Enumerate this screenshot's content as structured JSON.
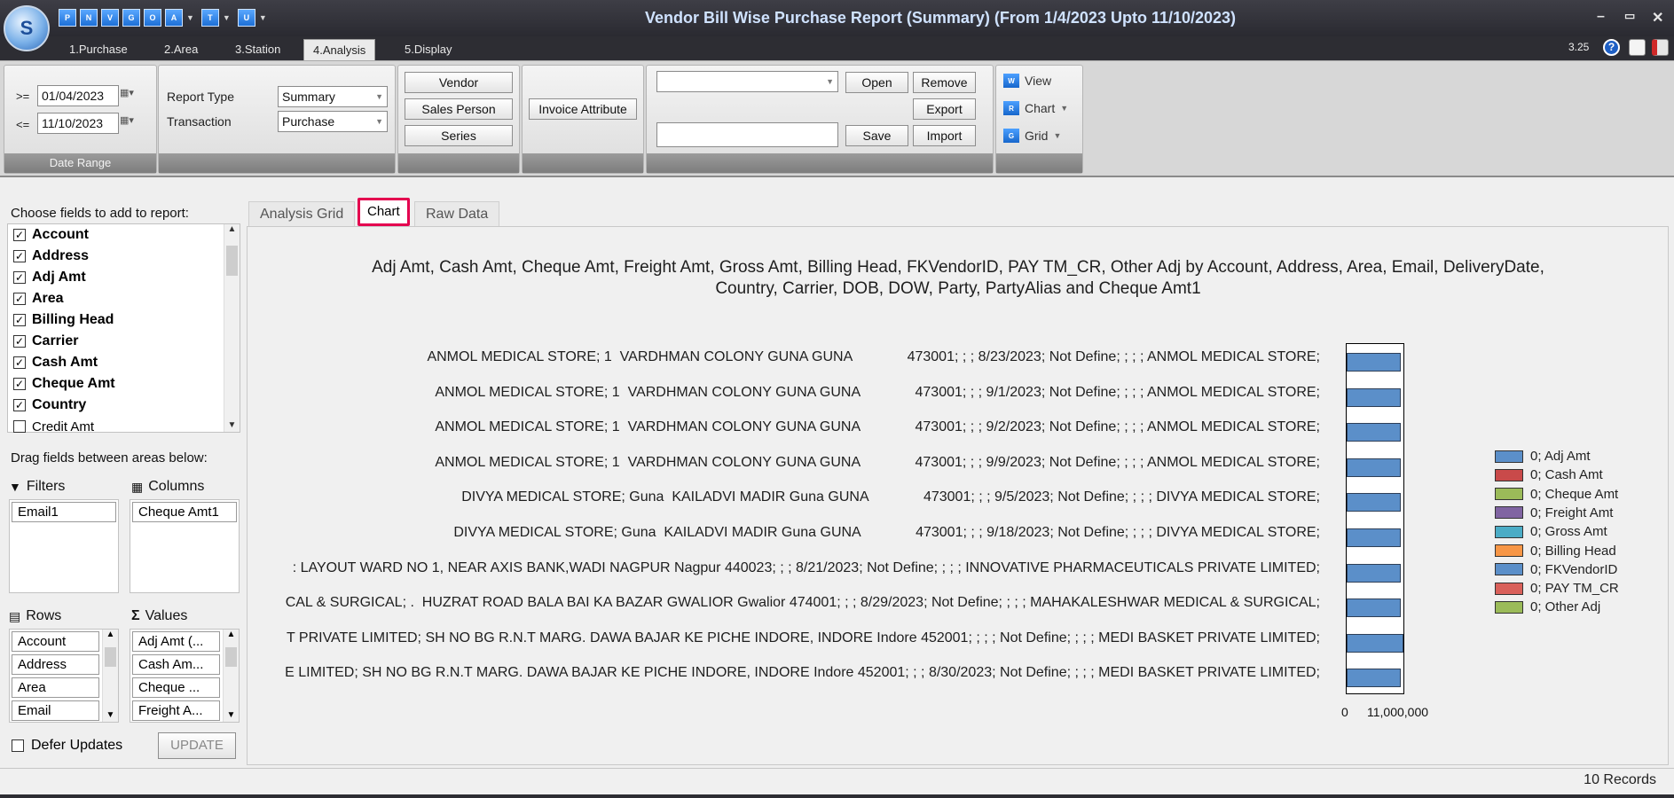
{
  "window": {
    "title": "Vendor Bill Wise Purchase Report (Summary) (From 1/4/2023 Upto 11/10/2023)",
    "logo_text": "S",
    "quick_access": [
      "P",
      "N",
      "V",
      "G",
      "O",
      "A",
      "T",
      "U"
    ],
    "controls": {
      "minimize": "–",
      "restore": "▭",
      "close": "✕"
    }
  },
  "menu_tabs": [
    "1.Purchase",
    "2.Area",
    "3.Station",
    "4.Analysis",
    "5.Display"
  ],
  "active_menu_tab": "4.Analysis",
  "version": "3.25",
  "ribbon": {
    "date_range": {
      "ge_label": ">=",
      "from": "01/04/2023",
      "le_label": "<=",
      "to": "11/10/2023",
      "group_label": "Date Range"
    },
    "report_type_label": "Report Type",
    "report_type_value": "Summary",
    "transaction_label": "Transaction",
    "transaction_value": "Purchase",
    "vendor": "Vendor",
    "sales_person": "Sales Person",
    "series": "Series",
    "invoice_attribute": "Invoice Attribute",
    "layout_select": "",
    "layout_name": "",
    "open": "Open",
    "save": "Save",
    "remove": "Remove",
    "export": "Export",
    "import": "Import",
    "view": "View",
    "chart": "Chart",
    "grid": "Grid"
  },
  "left": {
    "choose_label": "Choose fields to add to report:",
    "fields": [
      {
        "name": "Account",
        "checked": true
      },
      {
        "name": "Address",
        "checked": true
      },
      {
        "name": "Adj Amt",
        "checked": true
      },
      {
        "name": "Area",
        "checked": true
      },
      {
        "name": "Billing Head",
        "checked": true
      },
      {
        "name": "Carrier",
        "checked": true
      },
      {
        "name": "Cash Amt",
        "checked": true
      },
      {
        "name": "Cheque Amt",
        "checked": true
      },
      {
        "name": "Country",
        "checked": true
      },
      {
        "name": "Credit Amt",
        "checked": false
      }
    ],
    "drag_label": "Drag fields between areas below:",
    "filters_label": "Filters",
    "filters": [
      "Email1"
    ],
    "columns_label": "Columns",
    "columns": [
      "Cheque Amt1"
    ],
    "rows_label": "Rows",
    "rows": [
      "Account",
      "Address",
      "Area",
      "Email"
    ],
    "values_label": "Values",
    "values": [
      "Adj Amt (...",
      "Cash Am...",
      "Cheque ...",
      "Freight A..."
    ],
    "defer_label": "Defer Updates",
    "update_label": "UPDATE"
  },
  "content_tabs": [
    "Analysis Grid",
    "Chart",
    "Raw Data"
  ],
  "active_content_tab": "Chart",
  "status": {
    "records": "10 Records"
  },
  "chart_data": {
    "type": "bar",
    "orientation": "horizontal",
    "title_line1": "Adj Amt, Cash Amt, Cheque Amt, Freight Amt, Gross Amt, Billing Head, FKVendorID, PAY TM_CR, Other Adj by Account, Address, Area, Email, DeliveryDate,",
    "title_line2": "Country, Carrier, DOB, DOW, Party, PartyAlias and Cheque Amt1",
    "categories": [
      "ANMOL MEDICAL STORE; 1  VARDHMAN COLONY GUNA GUNA              473001; ; ; 8/23/2023; Not Define; ; ; ; ANMOL MEDICAL STORE;",
      "ANMOL MEDICAL STORE; 1  VARDHMAN COLONY GUNA GUNA              473001; ; ; 9/1/2023; Not Define; ; ; ; ANMOL MEDICAL STORE;",
      "ANMOL MEDICAL STORE; 1  VARDHMAN COLONY GUNA GUNA              473001; ; ; 9/2/2023; Not Define; ; ; ; ANMOL MEDICAL STORE;",
      "ANMOL MEDICAL STORE; 1  VARDHMAN COLONY GUNA GUNA              473001; ; ; 9/9/2023; Not Define; ; ; ; ANMOL MEDICAL STORE;",
      "DIVYA MEDICAL STORE; Guna  KAILADVI MADIR Guna GUNA              473001; ; ; 9/5/2023; Not Define; ; ; ; DIVYA MEDICAL STORE;",
      "DIVYA MEDICAL STORE; Guna  KAILADVI MADIR Guna GUNA              473001; ; ; 9/18/2023; Not Define; ; ; ; DIVYA MEDICAL STORE;",
      ": LAYOUT WARD NO 1, NEAR AXIS BANK,WADI NAGPUR Nagpur 440023; ; ; 8/21/2023; Not Define; ; ; ; INNOVATIVE PHARMACEUTICALS PRIVATE LIMITED;",
      "CAL & SURGICAL; .  HUZRAT ROAD BALA BAI KA BAZAR GWALIOR Gwalior 474001; ; ; 8/29/2023; Not Define; ; ; ; MAHAKALESHWAR MEDICAL & SURGICAL;",
      "T PRIVATE LIMITED; SH NO BG R.N.T MARG. DAWA BAJAR KE PICHE INDORE, INDORE Indore 452001; ; ; ; Not Define; ; ; ; MEDI BASKET PRIVATE LIMITED;",
      "E LIMITED; SH NO BG R.N.T MARG. DAWA BAJAR KE PICHE INDORE, INDORE Indore 452001; ; ; 8/30/2023; Not Define; ; ; ; MEDI BASKET PRIVATE LIMITED;"
    ],
    "values": [
      10500000,
      10500000,
      10500000,
      10500000,
      10500000,
      10500000,
      10500000,
      10500000,
      11000000,
      10500000
    ],
    "xlim": [
      0,
      11000000
    ],
    "xticks": [
      "0",
      "11,000,000"
    ],
    "bar_color": "#5b8fc9",
    "legend": [
      {
        "label": "0; Adj Amt",
        "color": "#5b8fc9"
      },
      {
        "label": "0; Cash Amt",
        "color": "#c94a4a"
      },
      {
        "label": "0; Cheque Amt",
        "color": "#9bbb59"
      },
      {
        "label": "0; Freight Amt",
        "color": "#8064a2"
      },
      {
        "label": "0; Gross Amt",
        "color": "#4bacc6"
      },
      {
        "label": "0; Billing Head",
        "color": "#f79646"
      },
      {
        "label": "0; FKVendorID",
        "color": "#5b8fc9"
      },
      {
        "label": "0; PAY TM_CR",
        "color": "#d9605a"
      },
      {
        "label": "0; Other Adj",
        "color": "#9bbb59"
      }
    ],
    "legend_position": "right"
  }
}
